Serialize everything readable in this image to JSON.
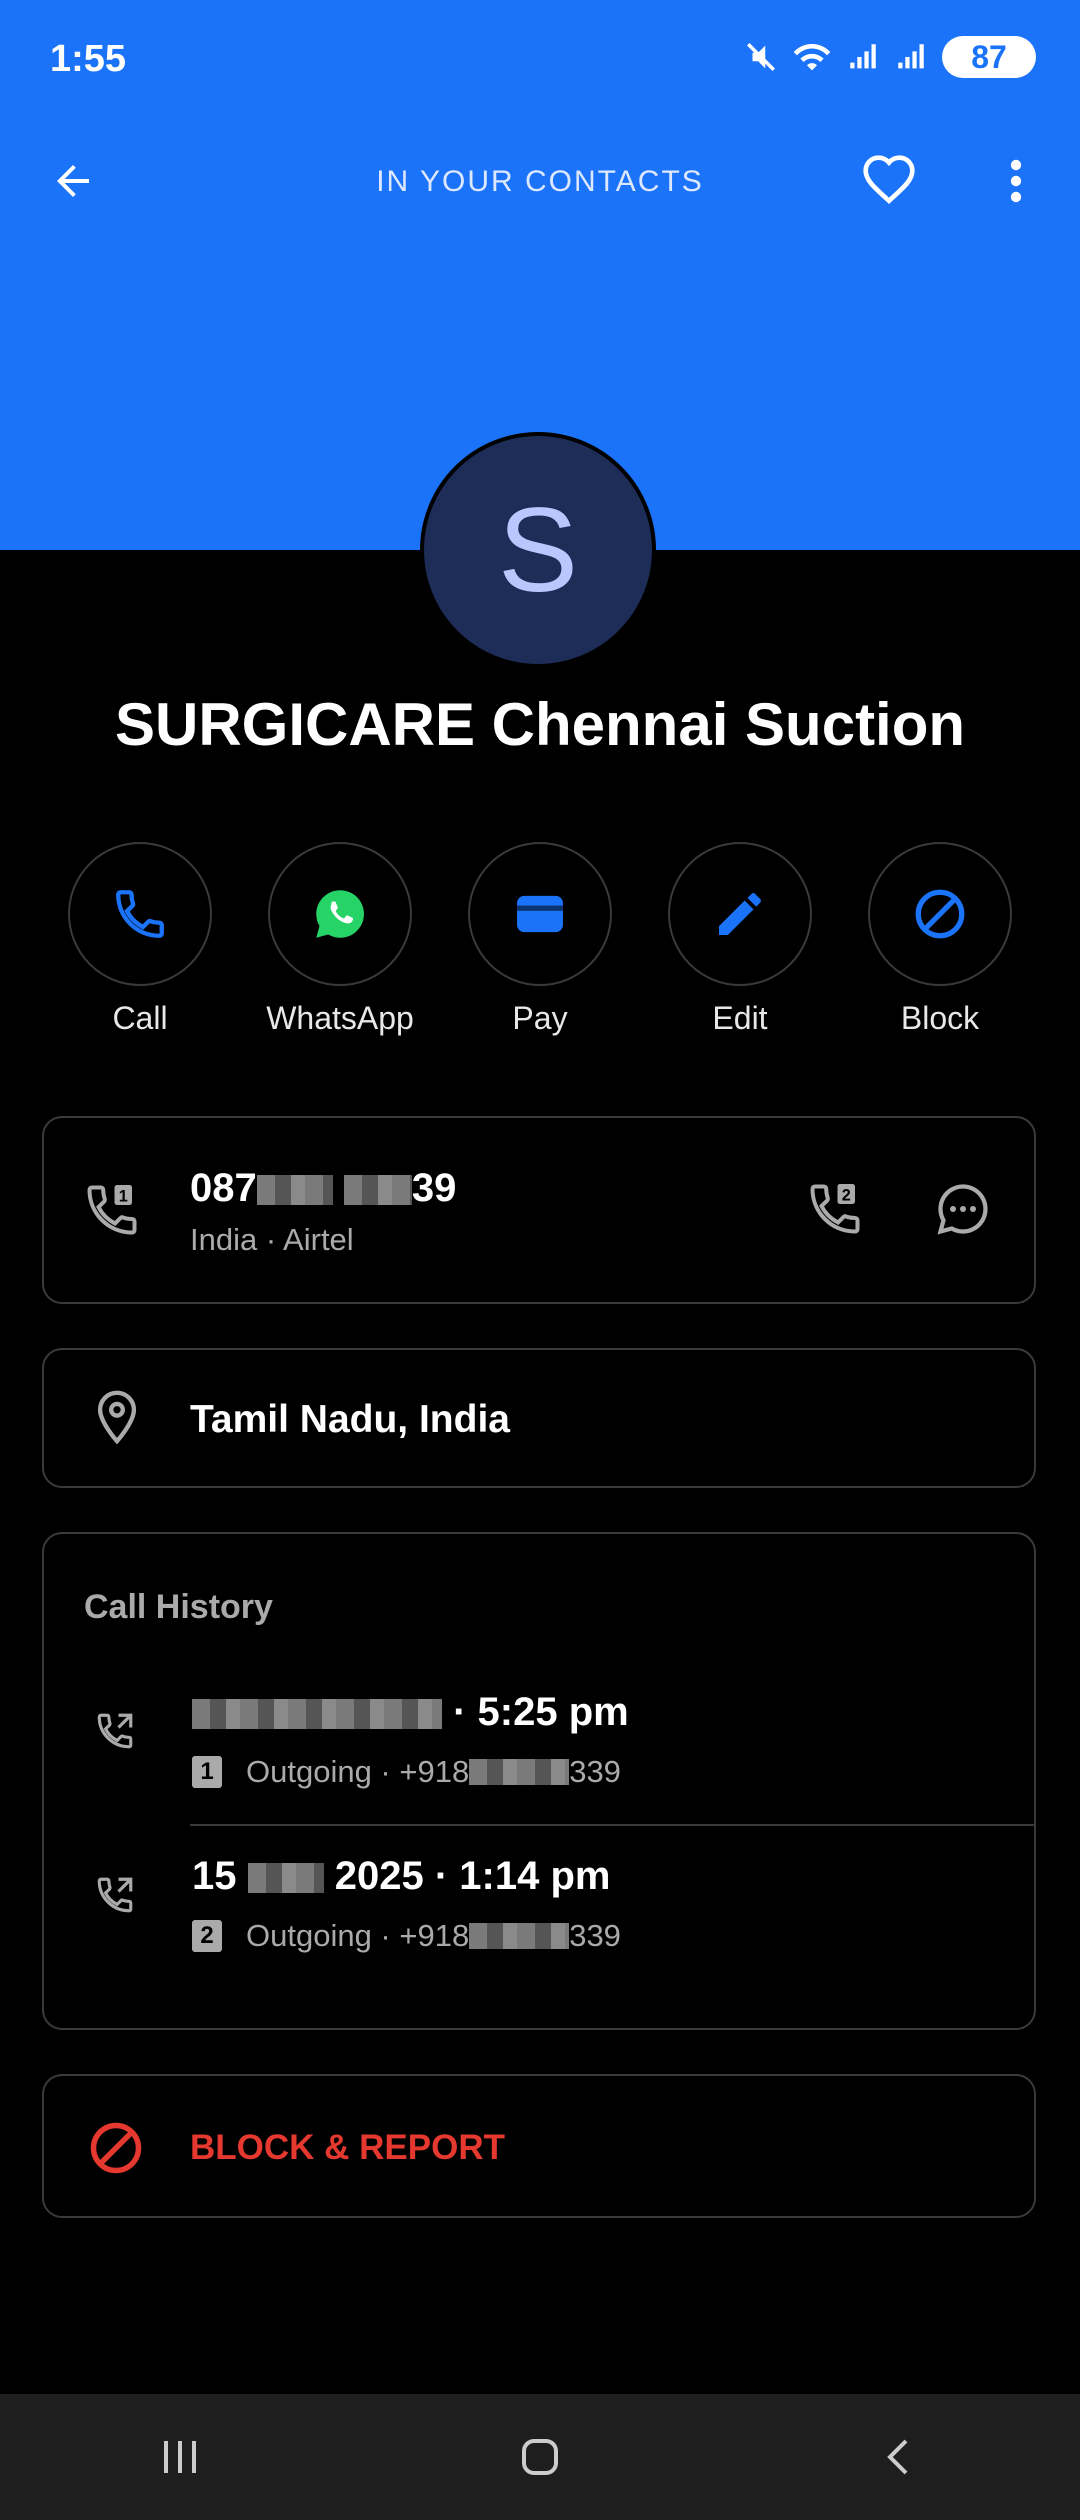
{
  "status_bar": {
    "time": "1:55",
    "battery": "87"
  },
  "header": {
    "title": "IN YOUR CONTACTS"
  },
  "contact": {
    "initial": "S",
    "name": "SURGICARE Chennai Suction"
  },
  "actions": [
    {
      "label": "Call",
      "icon": "phone-icon",
      "color": "#1a73f8"
    },
    {
      "label": "WhatsApp",
      "icon": "whatsapp-icon",
      "color": "#25d366"
    },
    {
      "label": "Pay",
      "icon": "wallet-icon",
      "color": "#1a73f8"
    },
    {
      "label": "Edit",
      "icon": "pencil-icon",
      "color": "#1a73f8"
    },
    {
      "label": "Block",
      "icon": "block-icon",
      "color": "#1a73f8"
    }
  ],
  "phone": {
    "number_prefix": "087",
    "number_suffix": "39",
    "meta": "India · Airtel"
  },
  "location": {
    "text": "Tamil Nadu, India"
  },
  "history": {
    "title": "Call History",
    "items": [
      {
        "date": "",
        "time": " · 5:25 pm",
        "sim": "1",
        "detail_prefix": "Outgoing · +918",
        "detail_suffix": "339"
      },
      {
        "date": "15 ",
        "date2": " 2025",
        "time": " · 1:14 pm",
        "sim": "2",
        "detail_prefix": "Outgoing · +918",
        "detail_suffix": "339"
      }
    ]
  },
  "block_report": {
    "label": "BLOCK & REPORT",
    "color": "#e5382f"
  }
}
